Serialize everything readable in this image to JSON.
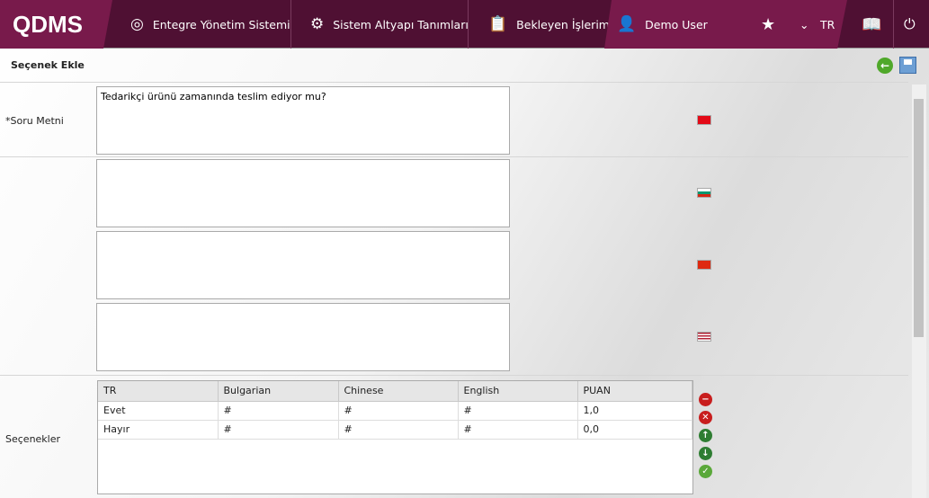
{
  "header": {
    "logo": "QDMS",
    "nav": [
      {
        "label": "Entegre Yönetim Sistemi",
        "icon": "q-icon"
      },
      {
        "label": "Sistem Altyapı Tanımları",
        "icon": "gear-icon"
      },
      {
        "label": "Bekleyen İşlerim",
        "icon": "clipboard-icon"
      }
    ],
    "user": "Demo User",
    "language": "TR"
  },
  "page": {
    "title": "Seçenek Ekle",
    "question_label": "*Soru Metni",
    "question_tr": "Tedarikçi ürünü zamanında teslim ediyor mu?",
    "question_bg": "",
    "question_zh": "",
    "question_en": "",
    "options_label": "Seçenekler"
  },
  "grid": {
    "columns": [
      "TR",
      "Bulgarian",
      "Chinese",
      "English",
      "PUAN"
    ],
    "rows": [
      [
        "Evet",
        "#",
        "#",
        "#",
        "1,0"
      ],
      [
        "Hayır",
        "#",
        "#",
        "#",
        "0,0"
      ]
    ]
  },
  "colors": {
    "header_dark": "#4f1033",
    "header_accent": "#781a4b"
  }
}
